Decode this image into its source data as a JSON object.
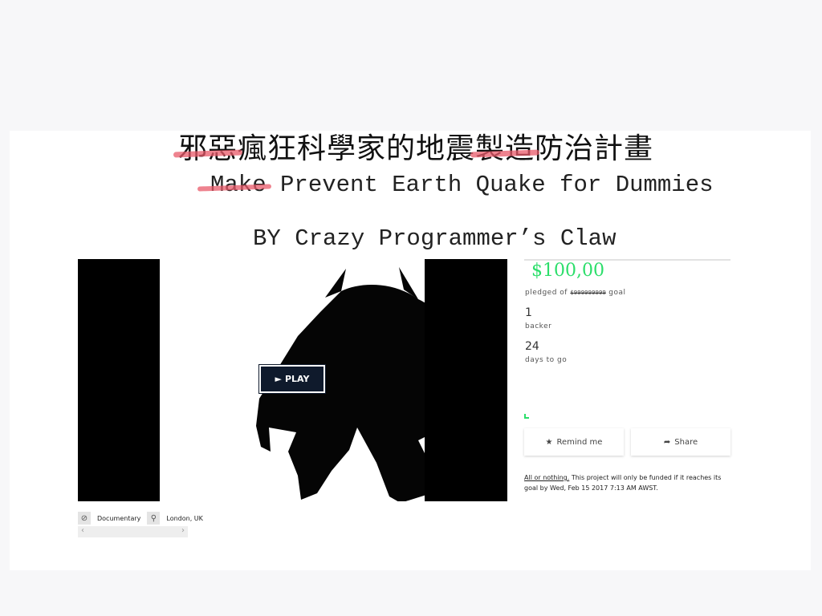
{
  "title": {
    "zh_struck_1": "邪惡",
    "zh_mid": "瘋狂科學家的地震",
    "zh_struck_2": "製造",
    "zh_end": "防治計畫",
    "en_struck": "Make",
    "en_rest": "Prevent Earth Quake for Dummies",
    "byline": "BY Crazy Programmer’s Claw"
  },
  "video": {
    "play_label": "PLAY",
    "play_icon": "play-triangle-icon"
  },
  "tags": {
    "category_icon": "compass-icon",
    "category": "Documentary",
    "location_icon": "map-pin-icon",
    "location": "London, UK"
  },
  "stats": {
    "pledged": "$100,00",
    "pledged_prefix": "pledged of",
    "goal": "$999999999",
    "goal_suffix": "goal",
    "backers": "1",
    "backers_label": "backer",
    "days": "24",
    "days_label": "days to go",
    "progress_fraction": 0
  },
  "actions": {
    "remind_icon": "star-icon",
    "remind_label": "Remind me",
    "share_icon": "share-arrow-icon",
    "share_label": "Share"
  },
  "funding": {
    "link": "All or nothing.",
    "text": "This project will only be funded if it reaches its goal by Wed, Feb 15 2017 7:13 AM AWST."
  },
  "colors": {
    "accent": "#2bde6a",
    "strike": "#e85a69",
    "play_bg": "#0f1a2c"
  }
}
